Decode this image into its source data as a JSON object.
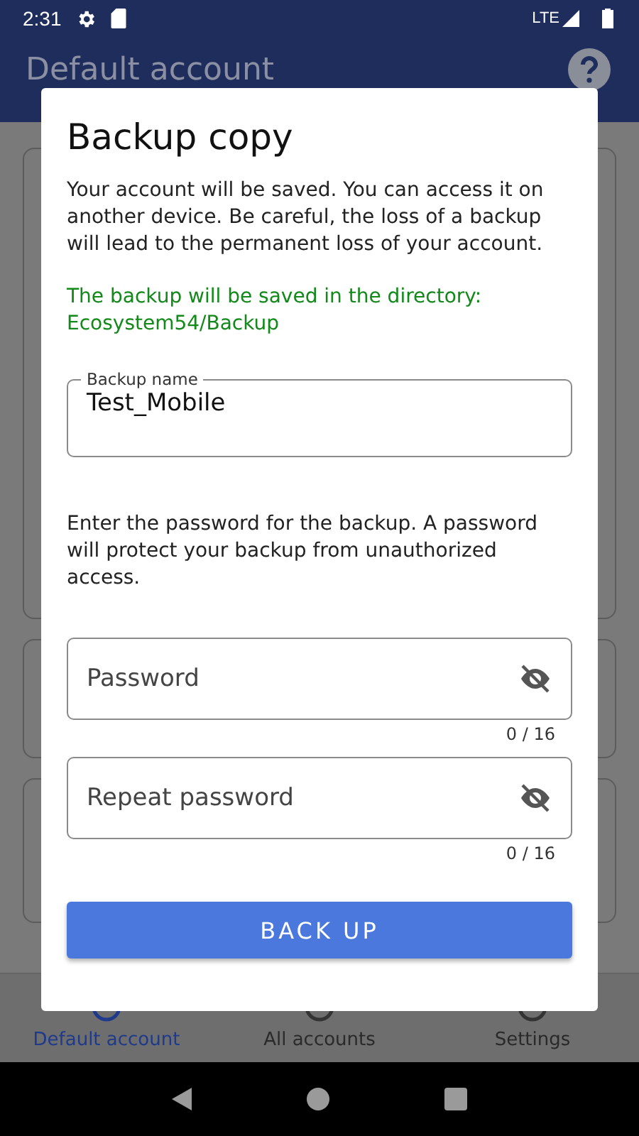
{
  "status_bar": {
    "time": "2:31",
    "network": "LTE"
  },
  "app_bar": {
    "title": "Default account"
  },
  "dialog": {
    "title": "Backup copy",
    "message": "Your account will be saved. You can access it on another device. Be careful, the loss of a backup will lead to the permanent loss of your account.",
    "directory_note": "The backup will be saved in the directory: Ecosystem54/Backup",
    "backup_name": {
      "label": "Backup name",
      "value": "Test_Mobile"
    },
    "password_prompt": "Enter the password for the backup. A password will protect your backup from unauthorized access.",
    "password_fields": [
      {
        "placeholder": "Password",
        "counter": "0 / 16"
      },
      {
        "placeholder": "Repeat password",
        "counter": "0 / 16"
      }
    ],
    "button": "BACK UP"
  },
  "bottom_nav": [
    {
      "label": "Default account",
      "selected": true
    },
    {
      "label": "All accounts",
      "selected": false
    },
    {
      "label": "Settings",
      "selected": false
    }
  ]
}
